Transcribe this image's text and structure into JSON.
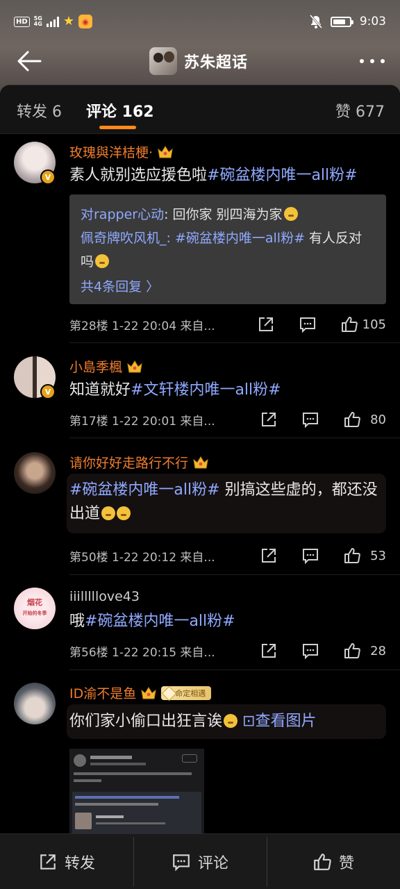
{
  "status_bar": {
    "left_label": "HD",
    "network_top": "5G",
    "network_bottom": "4G",
    "time": "9:03"
  },
  "header": {
    "title": "苏朱超话"
  },
  "tabs": {
    "repost": "转发 6",
    "comment": "评论 162",
    "like": "赞 677"
  },
  "comments": [
    {
      "username": "玫瑰與洋桔梗·",
      "text_plain": "素人就别选应援色啦",
      "tag": "#碗盆楼内唯一all粉#",
      "replies": [
        {
          "user": "对rapper心动",
          "text": ": 回你家 别四海为家"
        },
        {
          "user": "佩奇牌吹风机_",
          "text_tag": ": #碗盆楼内唯一all粉#",
          "text": " 有人反对吗"
        }
      ],
      "more_replies": "共4条回复 〉",
      "meta": "第28楼  1-22 20:04  来自...",
      "likes": "105",
      "verified_badge": "V"
    },
    {
      "username": "小島季楓",
      "text_plain": "知道就好",
      "tag": "#文轩楼内唯一all粉#",
      "meta": "第17楼  1-22 20:01  来自...",
      "likes": "80",
      "verified_badge": "V"
    },
    {
      "username": "请你好好走路行不行",
      "tag": "#碗盆楼内唯一all粉#",
      "text_plain": " 别搞这些虚的，都还没出道",
      "meta": "第50楼  1-22 20:12  来自...",
      "likes": "53"
    },
    {
      "username": "iiilllllove43",
      "text_plain": "哦",
      "tag": "#碗盆楼内唯一all粉#",
      "meta": "第56楼  1-22 20:15  来自...",
      "likes": "28",
      "avatar_text_1": "烟花",
      "avatar_text_2": "开始的冬季"
    },
    {
      "username": "ID渝不是鱼",
      "medal": "命定相遇",
      "text_plain": "你们家小偷口出狂言诶",
      "image_link": "⊡查看图片"
    }
  ],
  "bottom_bar": {
    "repost": "转发",
    "comment": "评论",
    "like": "赞"
  },
  "colors": {
    "accent_orange": "#ff8a1a",
    "username_orange": "#f07d2c",
    "link_blue": "#8fa9ff",
    "background": "#000000"
  },
  "icons": [
    "back-arrow-icon",
    "more-icon",
    "repost-icon",
    "comment-icon",
    "like-icon",
    "crown-icon"
  ]
}
